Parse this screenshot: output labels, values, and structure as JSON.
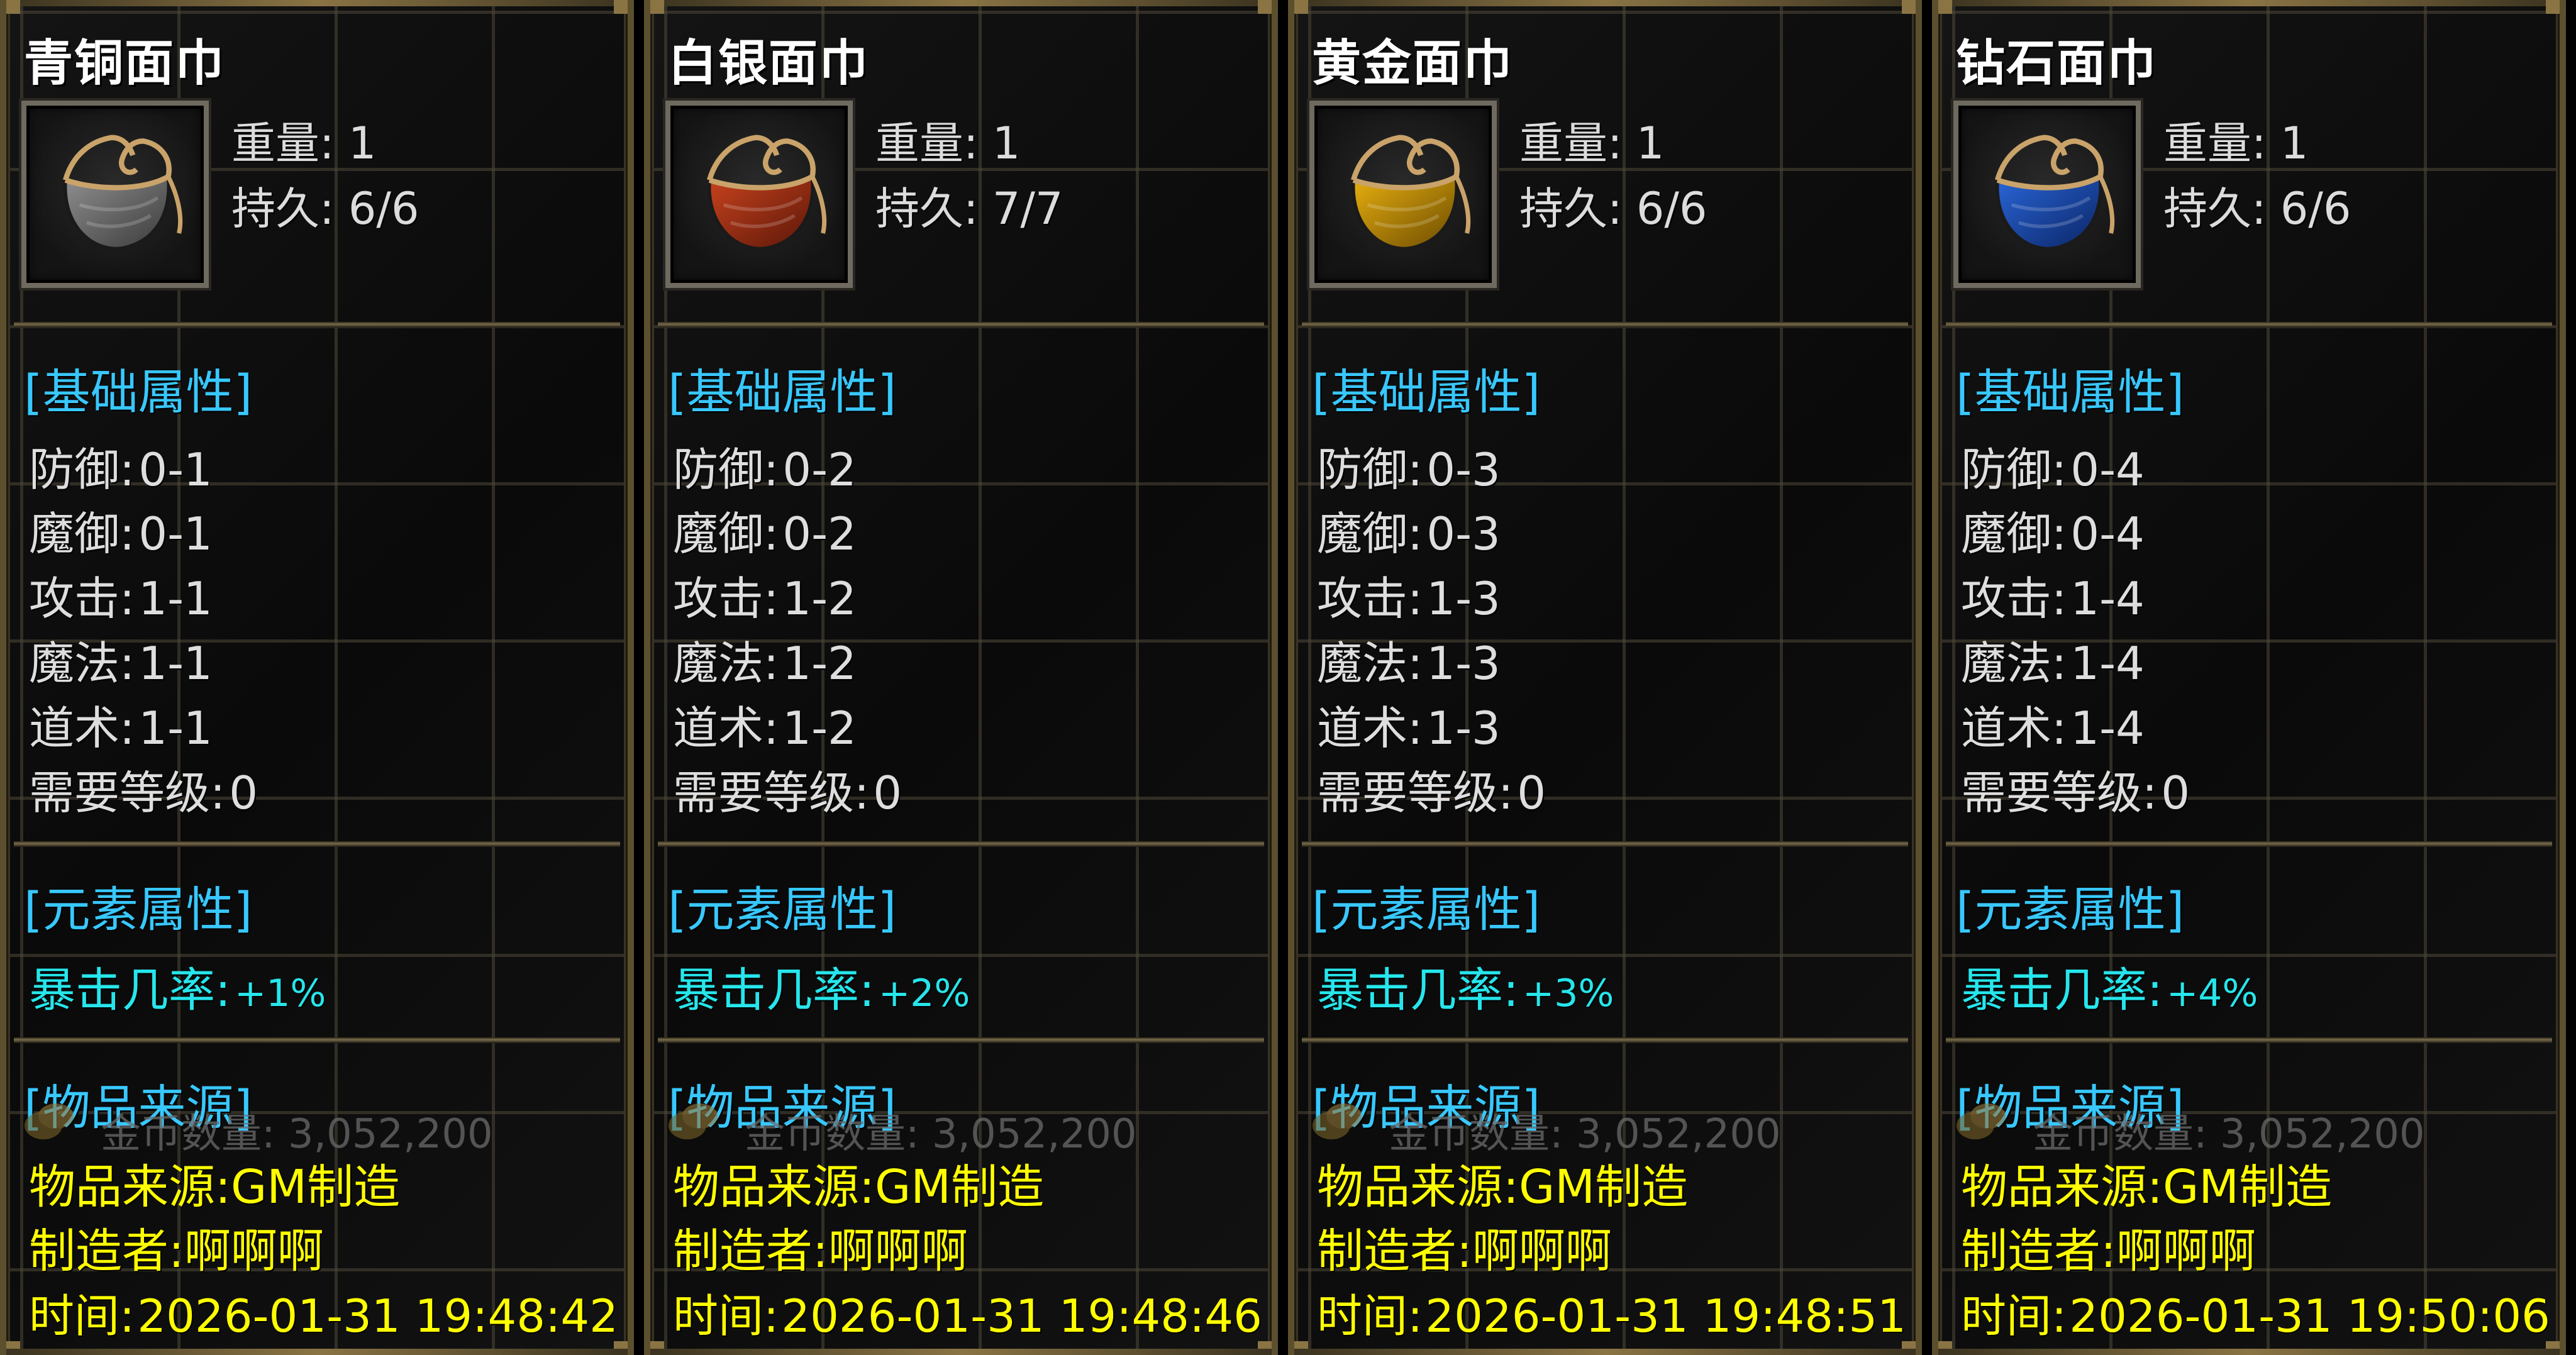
{
  "labels": {
    "weight": "重量:",
    "durability": "持久:",
    "base_section": "[基础属性]",
    "element_section": "[元素属性]",
    "source_section": "[物品来源]",
    "defense": "防御:",
    "magic_defense": "魔御:",
    "attack": "攻击:",
    "magic": "魔法:",
    "taoism": "道术:",
    "level_req": "需要等级:",
    "crit_rate": "暴击几率:",
    "gold_count": "金币数量:",
    "item_source": "物品来源:",
    "maker": "制造者:",
    "time": "时间:"
  },
  "items": [
    {
      "name": "青铜面巾",
      "weight": "1",
      "durability": "6/6",
      "defense": "0-1",
      "magic_defense": "0-1",
      "attack": "1-1",
      "magic": "1-1",
      "taoism": "1-1",
      "level_req": "0",
      "crit_rate": "+1%",
      "gold_count": "3,052,200",
      "item_source": "GM制造",
      "maker": "啊啊啊",
      "time": "2026-01-31 19:48:42",
      "mask_color": "#8f8f8f",
      "mask_color_dark": "#3a3a3a"
    },
    {
      "name": "白银面巾",
      "weight": "1",
      "durability": "7/7",
      "defense": "0-2",
      "magic_defense": "0-2",
      "attack": "1-2",
      "magic": "1-2",
      "taoism": "1-2",
      "level_req": "0",
      "crit_rate": "+2%",
      "gold_count": "3,052,200",
      "item_source": "GM制造",
      "maker": "啊啊啊",
      "time": "2026-01-31 19:48:46",
      "mask_color": "#c8431e",
      "mask_color_dark": "#5a1608"
    },
    {
      "name": "黄金面巾",
      "weight": "1",
      "durability": "6/6",
      "defense": "0-3",
      "magic_defense": "0-3",
      "attack": "1-3",
      "magic": "1-3",
      "taoism": "1-3",
      "level_req": "0",
      "crit_rate": "+3%",
      "gold_count": "3,052,200",
      "item_source": "GM制造",
      "maker": "啊啊啊",
      "time": "2026-01-31 19:48:51",
      "mask_color": "#e8b010",
      "mask_color_dark": "#6a4a00"
    },
    {
      "name": "钻石面巾",
      "weight": "1",
      "durability": "6/6",
      "defense": "0-4",
      "magic_defense": "0-4",
      "attack": "1-4",
      "magic": "1-4",
      "taoism": "1-4",
      "level_req": "0",
      "crit_rate": "+4%",
      "gold_count": "3,052,200",
      "item_source": "GM制造",
      "maker": "啊啊啊",
      "time": "2026-01-31 19:50:06",
      "mask_color": "#2a66d8",
      "mask_color_dark": "#0a2464"
    }
  ]
}
